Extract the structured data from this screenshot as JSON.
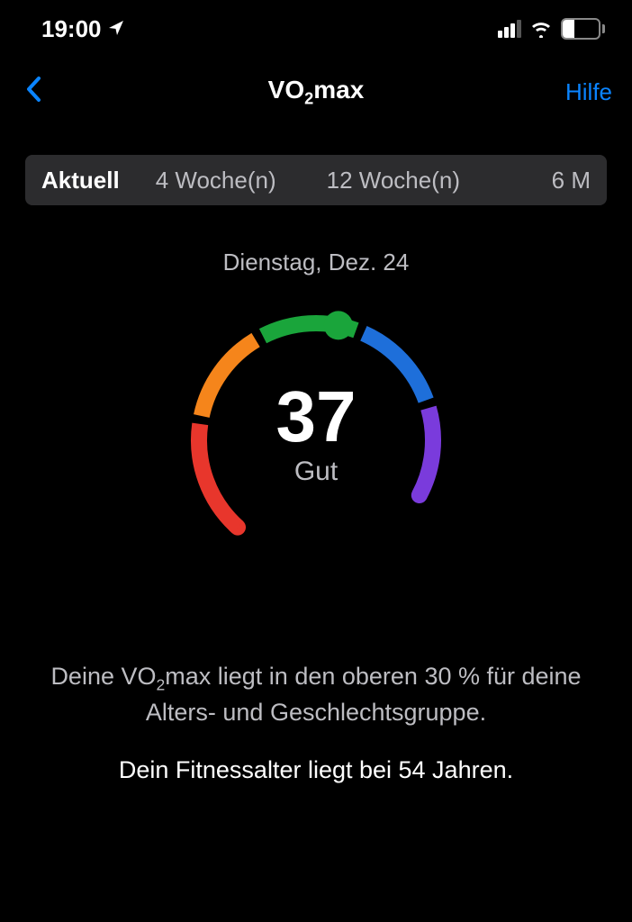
{
  "status": {
    "time": "19:00",
    "battery": "32"
  },
  "nav": {
    "title_pre": "VO",
    "title_sub": "2",
    "title_post": "max",
    "help": "Hilfe"
  },
  "tabs": {
    "t0": "Aktuell",
    "t1": "4 Woche(n)",
    "t2": "12 Woche(n)",
    "t3": "6 M"
  },
  "date": "Dienstag, Dez. 24",
  "gauge": {
    "value": "37",
    "status": "Gut",
    "colors": {
      "red": "#E8362C",
      "orange": "#F5851B",
      "green": "#1AA53B",
      "blue": "#1E6FDA",
      "purple": "#7A3BDC"
    }
  },
  "desc": {
    "pre": "Deine VO",
    "sub": "2",
    "post": "max liegt in den oberen 30 % für deine Alters- und Geschlechtsgruppe."
  },
  "fitness_age": "Dein Fitnessalter liegt bei 54 Jahren.",
  "chart_data": {
    "type": "gauge",
    "value": 37,
    "label": "Gut",
    "segments": [
      {
        "name": "poor",
        "color": "#E8362C",
        "range": [
          135,
          200
        ]
      },
      {
        "name": "fair",
        "color": "#F5851B",
        "range": [
          82,
          131
        ]
      },
      {
        "name": "good",
        "color": "#1AA53B",
        "range": [
          49,
          78
        ]
      },
      {
        "name": "excellent",
        "color": "#1E6FDA",
        "range": [
          0,
          45
        ]
      },
      {
        "name": "superior",
        "color": "#7A3BDC",
        "range": [
          -40,
          -4
        ]
      }
    ],
    "indicator_angle": 63,
    "start_angle": -40,
    "end_angle": 200
  }
}
